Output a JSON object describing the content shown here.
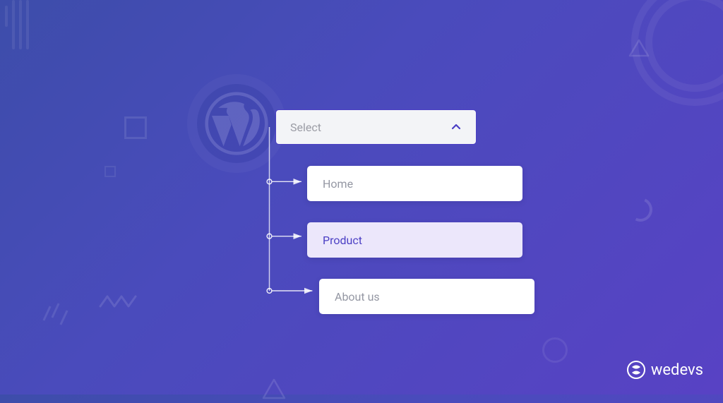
{
  "dropdown": {
    "select_label": "Select",
    "options": [
      {
        "label": "Home",
        "highlighted": false
      },
      {
        "label": "Product",
        "highlighted": true
      },
      {
        "label": "About us",
        "highlighted": false
      }
    ]
  },
  "brand": {
    "name": "wedevs"
  },
  "colors": {
    "accent": "#4b3fc4",
    "option_highlight_bg": "#ece7fb",
    "select_bg": "#f3f4f7",
    "text_muted": "#9b9ca5"
  }
}
